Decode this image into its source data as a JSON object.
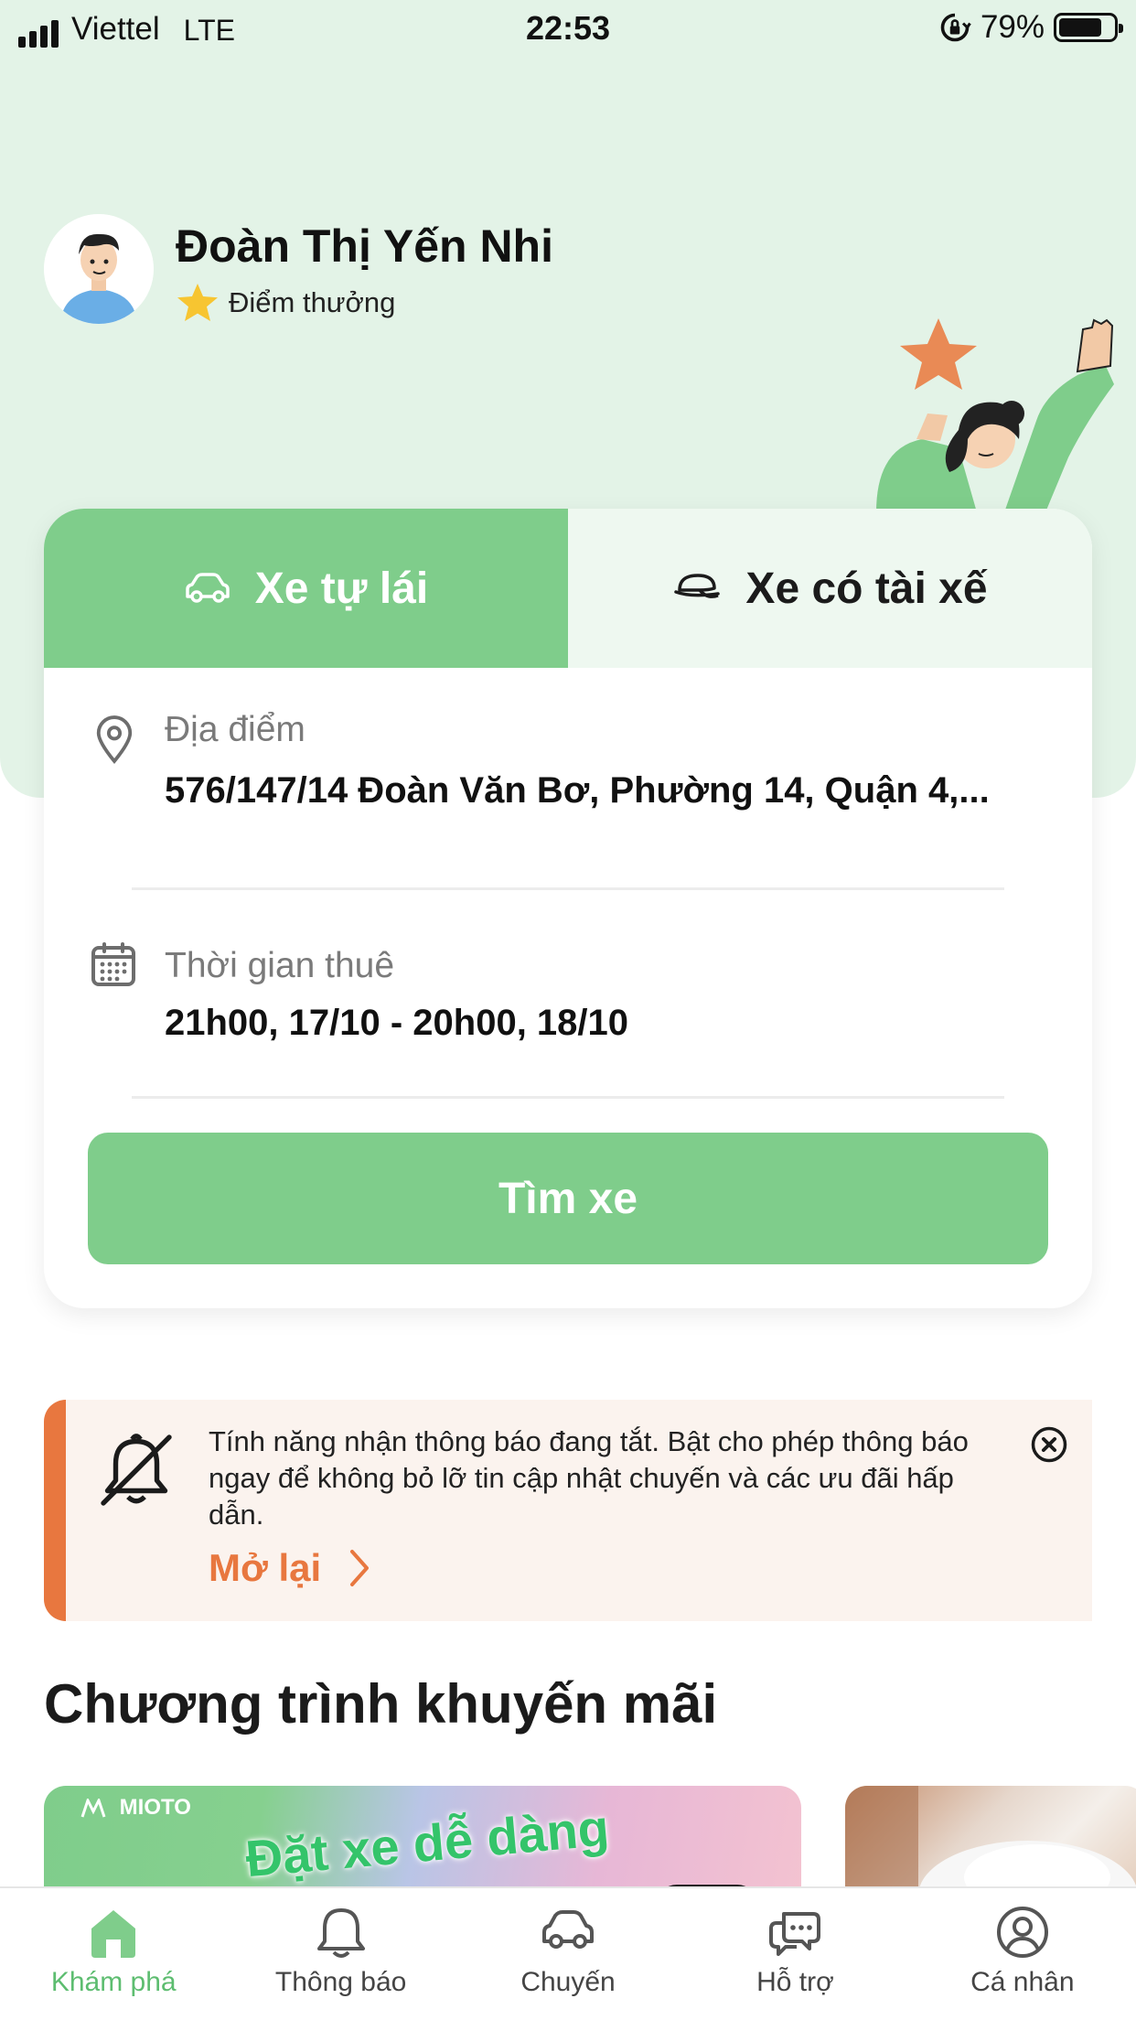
{
  "status_bar": {
    "carrier": "Viettel",
    "network": "LTE",
    "time": "22:53",
    "battery": "79%",
    "battery_level": 0.79
  },
  "profile": {
    "name": "Đoàn Thị Yến Nhi",
    "reward_label": "Điểm thưởng"
  },
  "tabs": [
    {
      "label": "Xe tự lái",
      "icon": "car-icon",
      "active": true
    },
    {
      "label": "Xe có tài xế",
      "icon": "driver-cap-icon",
      "active": false
    }
  ],
  "search": {
    "location_label": "Địa điểm",
    "location_value": "576/147/14 Đoàn Văn Bơ, Phường 14, Quận 4,...",
    "time_label": "Thời gian thuê",
    "time_value": "21h00, 17/10 - 20h00, 18/10",
    "button_label": "Tìm xe"
  },
  "notice": {
    "text": "Tính năng nhận thông báo đang tắt. Bật cho phép thông báo ngay để không bỏ lỡ tin cập nhật chuyến và các ưu đãi hấp dẫn.",
    "link_label": "Mở lại"
  },
  "promotions": {
    "title": "Chương trình khuyến mãi",
    "banner_brand": "MIOTO",
    "banner_text": "Đặt xe dễ dàng"
  },
  "colors": {
    "accent": "#7fcd8b",
    "hero_bg": "#e3f3e7",
    "warning": "#e8773f"
  },
  "bottom_nav": [
    {
      "label": "Khám phá",
      "icon": "home-icon",
      "active": true
    },
    {
      "label": "Thông báo",
      "icon": "bell-icon",
      "active": false
    },
    {
      "label": "Chuyến",
      "icon": "car-icon",
      "active": false
    },
    {
      "label": "Hỗ trợ",
      "icon": "chat-icon",
      "active": false
    },
    {
      "label": "Cá nhân",
      "icon": "user-icon",
      "active": false
    }
  ]
}
